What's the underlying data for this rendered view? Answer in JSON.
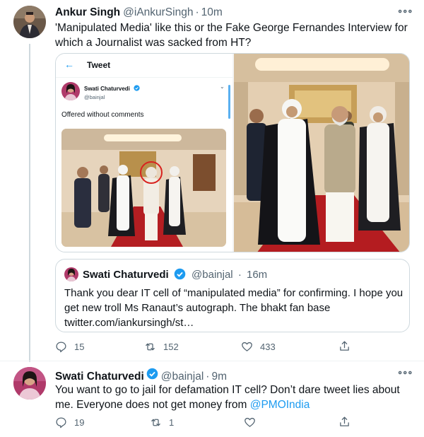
{
  "colors": {
    "accent": "#1d9bf0",
    "secondary_text": "#536471",
    "border": "#cfd9de"
  },
  "tweet1": {
    "name": "Ankur Singh",
    "handle": "@iAnkurSingh",
    "dot": "·",
    "time": "10m",
    "more": "∘∘∘",
    "text": "'Manipulated Media' like this or the Fake George Fernandes Interview for which a Journalist was sacked from HT?",
    "embedded_screenshot": {
      "back_icon": "arrow-left-icon",
      "title": "Tweet",
      "name": "Swati Chaturvedi",
      "handle": "@bainjal",
      "text": "Offered without comments"
    },
    "quote": {
      "name": "Swati Chaturvedi",
      "handle": "@bainjal",
      "dot": "·",
      "time": "16m",
      "text": "Thank you dear IT cell of “manipulated media” for confirming. I hope you get new troll Ms Ranaut’s autograph. The bhakt fan base twitter.com/iankursingh/st…"
    },
    "actions": {
      "replies": "15",
      "retweets": "152",
      "likes": "433"
    }
  },
  "tweet2": {
    "name": "Swati Chaturvedi",
    "handle": "@bainjal",
    "dot": "·",
    "time": "9m",
    "more": "∘∘∘",
    "text_before_mention": "You want to go to jail for defamation IT cell? Don’t dare tweet lies about me. Everyone does not get money from ",
    "mention": "@PMOIndia",
    "actions": {
      "replies": "19",
      "retweets": "1",
      "likes": ""
    }
  },
  "icons": [
    "reply-icon",
    "retweet-icon",
    "like-icon",
    "share-icon",
    "verified-badge-icon",
    "more-options-icon"
  ]
}
